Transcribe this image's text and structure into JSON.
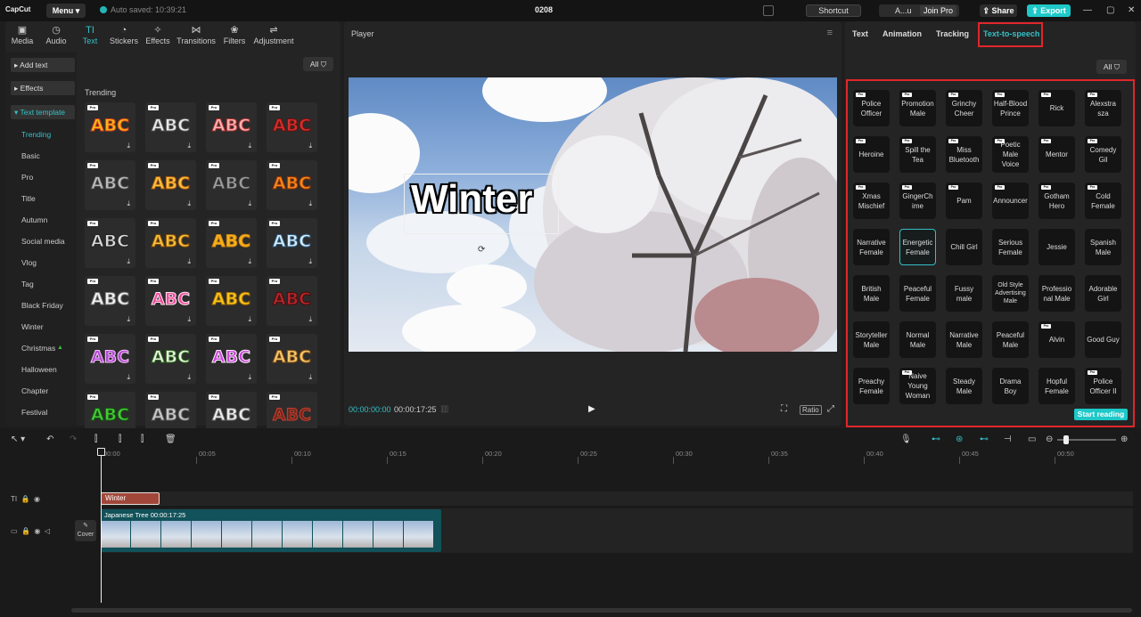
{
  "app": {
    "logo": "CapCut",
    "menu_label": "Menu",
    "saved_status": "Auto saved: 10:39:21",
    "project_name": "0208"
  },
  "topbar": {
    "shortcut_label": "Shortcut",
    "account_label": "A...u",
    "join_pro_label": "Join Pro",
    "share_label": "Share",
    "export_label": "Export"
  },
  "media_tabs": [
    {
      "label": "Media",
      "icon": "▣"
    },
    {
      "label": "Audio",
      "icon": "◷"
    },
    {
      "label": "Text",
      "icon": "TI"
    },
    {
      "label": "Stickers",
      "icon": "◔"
    },
    {
      "label": "Effects",
      "icon": "✧"
    },
    {
      "label": "Transitions",
      "icon": "⋈"
    },
    {
      "label": "Filters",
      "icon": "❀"
    },
    {
      "label": "Adjustment",
      "icon": "⇌"
    }
  ],
  "text_categories": {
    "add_text": "Add text",
    "effects": "Effects",
    "text_template": "Text template",
    "subcategories": [
      "Trending",
      "Basic",
      "Pro",
      "Title",
      "Autumn",
      "Social media",
      "Vlog",
      "Tag",
      "Black Friday",
      "Winter",
      "Christmas",
      "Halloween",
      "Chapter",
      "Festival"
    ]
  },
  "templates": {
    "filter_label": "All",
    "section_title": "Trending",
    "pro_badge": "Pro",
    "items": [
      {
        "text": "ABC",
        "color": "#f6b51a",
        "stroke": "#d2391c"
      },
      {
        "text": "ABC",
        "color": "#e8e8e8",
        "stroke": "#555555"
      },
      {
        "text": "ABC",
        "color": "#f7b3b3",
        "stroke": "#b03030"
      },
      {
        "text": "ABC",
        "color": "#d0302c",
        "stroke": "#6a0f0f"
      },
      {
        "text": "ABC",
        "color": "#b9b9b9",
        "stroke": "#444444"
      },
      {
        "text": "ABC",
        "color": "#f7c23a",
        "stroke": "#b15a14"
      },
      {
        "text": "ABC",
        "color": "#9a9a9a",
        "stroke": "#333333"
      },
      {
        "text": "ABC",
        "color": "#f08a1c",
        "stroke": "#9a2f06"
      },
      {
        "text": "ABC",
        "color": "#d8d8d8",
        "stroke": "#222222"
      },
      {
        "text": "ABC",
        "color": "#f5c03b",
        "stroke": "#8a4f06"
      },
      {
        "text": "ABC",
        "color": "#f6b11b",
        "stroke": "#d08510"
      },
      {
        "text": "ABC",
        "color": "#d6ecf5",
        "stroke": "#2a5a86"
      },
      {
        "text": "ABC",
        "color": "#f2f2f2",
        "stroke": "#777777"
      },
      {
        "text": "ABC",
        "color": "#f04b9c",
        "stroke": "#ffe7f0"
      },
      {
        "text": "ABC",
        "color": "#f8c51e",
        "stroke": "#a26c02"
      },
      {
        "text": "ABC",
        "color": "#b3262c",
        "stroke": "#4a0a0a"
      },
      {
        "text": "ABC",
        "color": "#b34ad1",
        "stroke": "#f1c5f8"
      },
      {
        "text": "ABC",
        "color": "#e8f2e1",
        "stroke": "#2e6b1c"
      },
      {
        "text": "ABC",
        "color": "#c94ad8",
        "stroke": "#fff0ff"
      },
      {
        "text": "ABC",
        "color": "#f1c76d",
        "stroke": "#8a4e12"
      },
      {
        "text": "ABC",
        "color": "#49c63b",
        "stroke": "#0d5a0a"
      },
      {
        "text": "ABC",
        "color": "#c7c7c7",
        "stroke": "#555555"
      },
      {
        "text": "ABC",
        "color": "#ececec",
        "stroke": "#666666"
      },
      {
        "text": "ABC",
        "color": "#6e2b20",
        "stroke": "#d03b2b"
      }
    ]
  },
  "player": {
    "title": "Player",
    "overlay_text": "Winter",
    "current_time": "00:00:00:00",
    "duration": "00:00:17:25",
    "ratio_label": "Ratio"
  },
  "right_panel": {
    "tabs": [
      "Text",
      "Animation",
      "Tracking",
      "Text-to-speech"
    ],
    "active_tab": "Text-to-speech",
    "filter_label": "All",
    "start_reading_label": "Start reading",
    "pro_badge": "Pro",
    "voices": [
      {
        "name": "Police Officer",
        "pro": true
      },
      {
        "name": "Promotion Male",
        "pro": true
      },
      {
        "name": "Grinchy Cheer",
        "pro": true
      },
      {
        "name": "Half-Blood Prince",
        "pro": true
      },
      {
        "name": "Rick",
        "pro": true
      },
      {
        "name": "Alexstra sza",
        "pro": true
      },
      {
        "name": "Heroine",
        "pro": true
      },
      {
        "name": "Spill the Tea",
        "pro": true
      },
      {
        "name": "Miss Bluetooth",
        "pro": true
      },
      {
        "name": "Poetic Male Voice",
        "pro": true
      },
      {
        "name": "Mentor",
        "pro": true
      },
      {
        "name": "Comedy Gil",
        "pro": true
      },
      {
        "name": "Xmas Mischief",
        "pro": true
      },
      {
        "name": "GingerCh ime",
        "pro": true
      },
      {
        "name": "Pam",
        "pro": true
      },
      {
        "name": "Announcer",
        "pro": true
      },
      {
        "name": "Gotham Hero",
        "pro": true
      },
      {
        "name": "Cold Female",
        "pro": true
      },
      {
        "name": "Narrative Female",
        "pro": false
      },
      {
        "name": "Energetic Female",
        "pro": false,
        "selected": true
      },
      {
        "name": "Chill Girl",
        "pro": false
      },
      {
        "name": "Serious Female",
        "pro": false
      },
      {
        "name": "Jessie",
        "pro": false
      },
      {
        "name": "Spanish Male",
        "pro": false
      },
      {
        "name": "British Male",
        "pro": false
      },
      {
        "name": "Peaceful Female",
        "pro": false
      },
      {
        "name": "Fussy male",
        "pro": false
      },
      {
        "name": "Old Style Advertising Male",
        "pro": false
      },
      {
        "name": "Professio nal Male",
        "pro": false
      },
      {
        "name": "Adorable Girl",
        "pro": false
      },
      {
        "name": "Storyteller Male",
        "pro": false
      },
      {
        "name": "Normal Male",
        "pro": false
      },
      {
        "name": "Narrative Male",
        "pro": false
      },
      {
        "name": "Peaceful Male",
        "pro": false
      },
      {
        "name": "Alvin",
        "pro": true
      },
      {
        "name": "Good Guy",
        "pro": false
      },
      {
        "name": "Preachy Female",
        "pro": false
      },
      {
        "name": "Naive Young Woman",
        "pro": true
      },
      {
        "name": "Steady Male",
        "pro": false
      },
      {
        "name": "Drama Boy",
        "pro": false
      },
      {
        "name": "Hopful Female",
        "pro": false
      },
      {
        "name": "Police Officer II",
        "pro": true
      }
    ]
  },
  "timeline": {
    "ruler": [
      "00:00",
      "00:05",
      "00:10",
      "00:15",
      "00:20",
      "00:25",
      "00:30",
      "00:35",
      "00:40",
      "00:45",
      "00:50"
    ],
    "text_clip_label": "Winter",
    "video_clip_label": "Japanese Tree  00:00:17:25",
    "cover_label": "Cover"
  },
  "colors": {
    "accent": "#1ec8c8",
    "highlight": "#e0262b",
    "text_clip": "#a0473a",
    "video_clip": "#12525a"
  }
}
